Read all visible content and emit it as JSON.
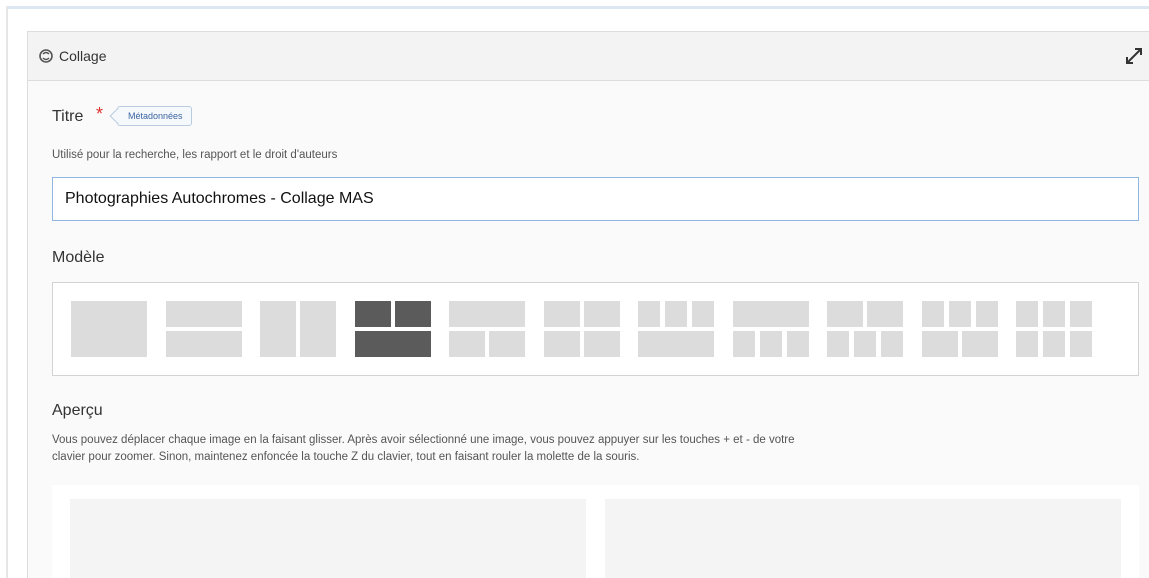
{
  "panel": {
    "title": "Collage",
    "icon": "puzzle-icon",
    "expand_icon": "expand-icon"
  },
  "title_field": {
    "label": "Titre",
    "required_mark": "*",
    "tag": "Métadonnées",
    "help": "Utilisé pour la recherche, les rapport et le droit d'auteurs",
    "value": "Photographies Autochromes - Collage MAS"
  },
  "model": {
    "label": "Modèle",
    "selected_index": 3,
    "template_count": 11
  },
  "preview": {
    "label": "Aperçu",
    "help_line1": "Vous pouvez déplacer chaque image en la faisant glisser. Après avoir sélectionné une image, vous pouvez appuyer sur les touches + et - de votre",
    "help_line2": "clavier pour zoomer. Sinon, maintenez enfoncée la touche Z du clavier, tout en faisant rouler la molette de la souris."
  },
  "colors": {
    "selected_template": "#5b5b5b",
    "template": "#dcdcdc",
    "required": "#e0312e",
    "input_border": "#8fb6e0"
  }
}
